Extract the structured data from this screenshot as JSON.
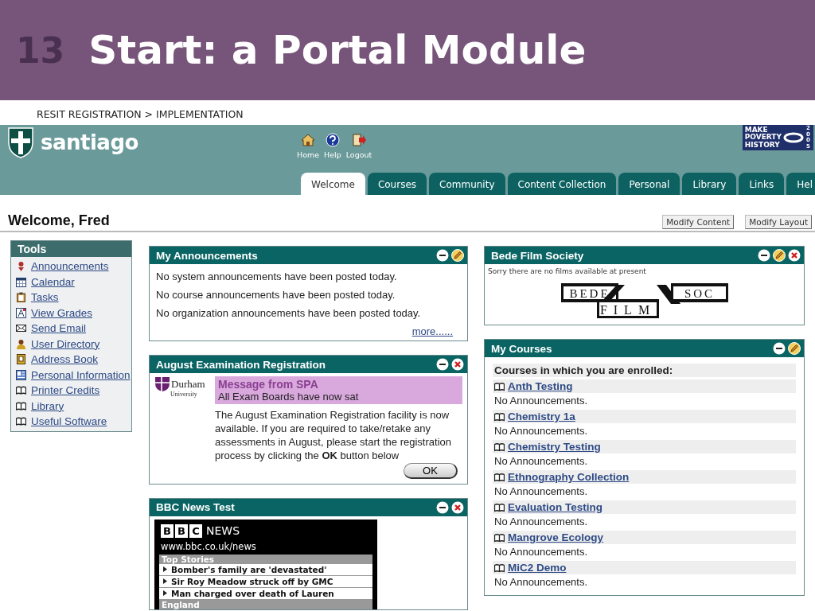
{
  "slide": {
    "number": "13",
    "title": "Start: a Portal Module",
    "breadcrumb": "RESIT REGISTRATION > IMPLEMENTATION"
  },
  "portal": {
    "brand": "santiago",
    "nav": [
      {
        "kind": "home",
        "label": "Home"
      },
      {
        "kind": "help",
        "label": "Help"
      },
      {
        "kind": "logout",
        "label": "Logout"
      }
    ],
    "banner": {
      "lines": [
        "MAKE",
        "POVERTY",
        "HISTORY"
      ],
      "year": "2005"
    },
    "tabs": [
      {
        "label": "Welcome",
        "selected": true
      },
      {
        "label": "Courses",
        "selected": false
      },
      {
        "label": "Community",
        "selected": false
      },
      {
        "label": "Content Collection",
        "selected": false
      },
      {
        "label": "Personal",
        "selected": false
      },
      {
        "label": "Library",
        "selected": false
      },
      {
        "label": "Links",
        "selected": false
      },
      {
        "label": "Hel",
        "selected": false
      }
    ],
    "welcome": "Welcome, Fred",
    "page_buttons": [
      "Modify Content",
      "Modify Layout"
    ],
    "tools": {
      "title": "Tools",
      "items": [
        {
          "kind": "pin",
          "label": "Announcements"
        },
        {
          "kind": "calendar",
          "label": "Calendar"
        },
        {
          "kind": "clipboard",
          "label": "Tasks"
        },
        {
          "kind": "grades",
          "label": "View Grades"
        },
        {
          "kind": "envelope",
          "label": "Send Email"
        },
        {
          "kind": "person",
          "label": "User Directory"
        },
        {
          "kind": "address-book",
          "label": "Address Book"
        },
        {
          "kind": "card",
          "label": "Personal Information"
        },
        {
          "kind": "book",
          "label": "Printer Credits"
        },
        {
          "kind": "book",
          "label": "Library"
        },
        {
          "kind": "book",
          "label": "Useful Software"
        }
      ]
    },
    "announcements": {
      "title": "My Announcements",
      "controls": [
        {
          "kind": "minimize"
        },
        {
          "kind": "edit"
        }
      ],
      "lines": [
        "No system announcements have been posted today.",
        "No course announcements have been posted today.",
        "No organization announcements have been posted today."
      ],
      "more": "more......"
    },
    "exam": {
      "title": "August Examination Registration",
      "controls": [
        {
          "kind": "minimize"
        },
        {
          "kind": "close"
        }
      ],
      "logo": {
        "name": "Durham",
        "sub": "University"
      },
      "message_title": "Message from SPA",
      "message_sub": "All Exam Boards have now sat",
      "body": "The August Examination Registration facility is now available. If you are required to take/retake any assessments in August, please start the registration process by clicking the **OK** button below",
      "button": "OK"
    },
    "bbc": {
      "title": "BBC News Test",
      "controls": [
        {
          "kind": "minimize"
        },
        {
          "kind": "close"
        }
      ],
      "logo_letters": [
        "B",
        "B",
        "C"
      ],
      "logo_word": "NEWS",
      "url": "www.bbc.co.uk/news",
      "sections": [
        {
          "heading": "Top Stories",
          "stories": [
            "Bomber's family are 'devastated'",
            "Sir Roy Meadow struck off by GMC",
            "Man charged over death of Lauren"
          ]
        },
        {
          "heading": "England"
        }
      ]
    },
    "film": {
      "title": "Bede Film Society",
      "controls": [
        {
          "kind": "minimize"
        },
        {
          "kind": "edit"
        },
        {
          "kind": "close"
        }
      ],
      "notice": "Sorry there are no films available at present",
      "logo": [
        "BEDE",
        "FILM",
        "SOC"
      ]
    },
    "courses": {
      "title": "My Courses",
      "controls": [
        {
          "kind": "minimize"
        },
        {
          "kind": "edit"
        }
      ],
      "heading": "Courses in which you are enrolled:",
      "items": [
        {
          "name": "Anth Testing",
          "note": "No Announcements."
        },
        {
          "name": "Chemistry 1a",
          "note": "No Announcements."
        },
        {
          "name": "Chemistry Testing",
          "note": "No Announcements."
        },
        {
          "name": "Ethnography Collection",
          "note": "No Announcements."
        },
        {
          "name": "Evaluation Testing",
          "note": "No Announcements."
        },
        {
          "name": "Mangrove Ecology",
          "note": "No Announcements."
        },
        {
          "name": "MiC2 Demo",
          "note": "No Announcements."
        }
      ]
    }
  }
}
